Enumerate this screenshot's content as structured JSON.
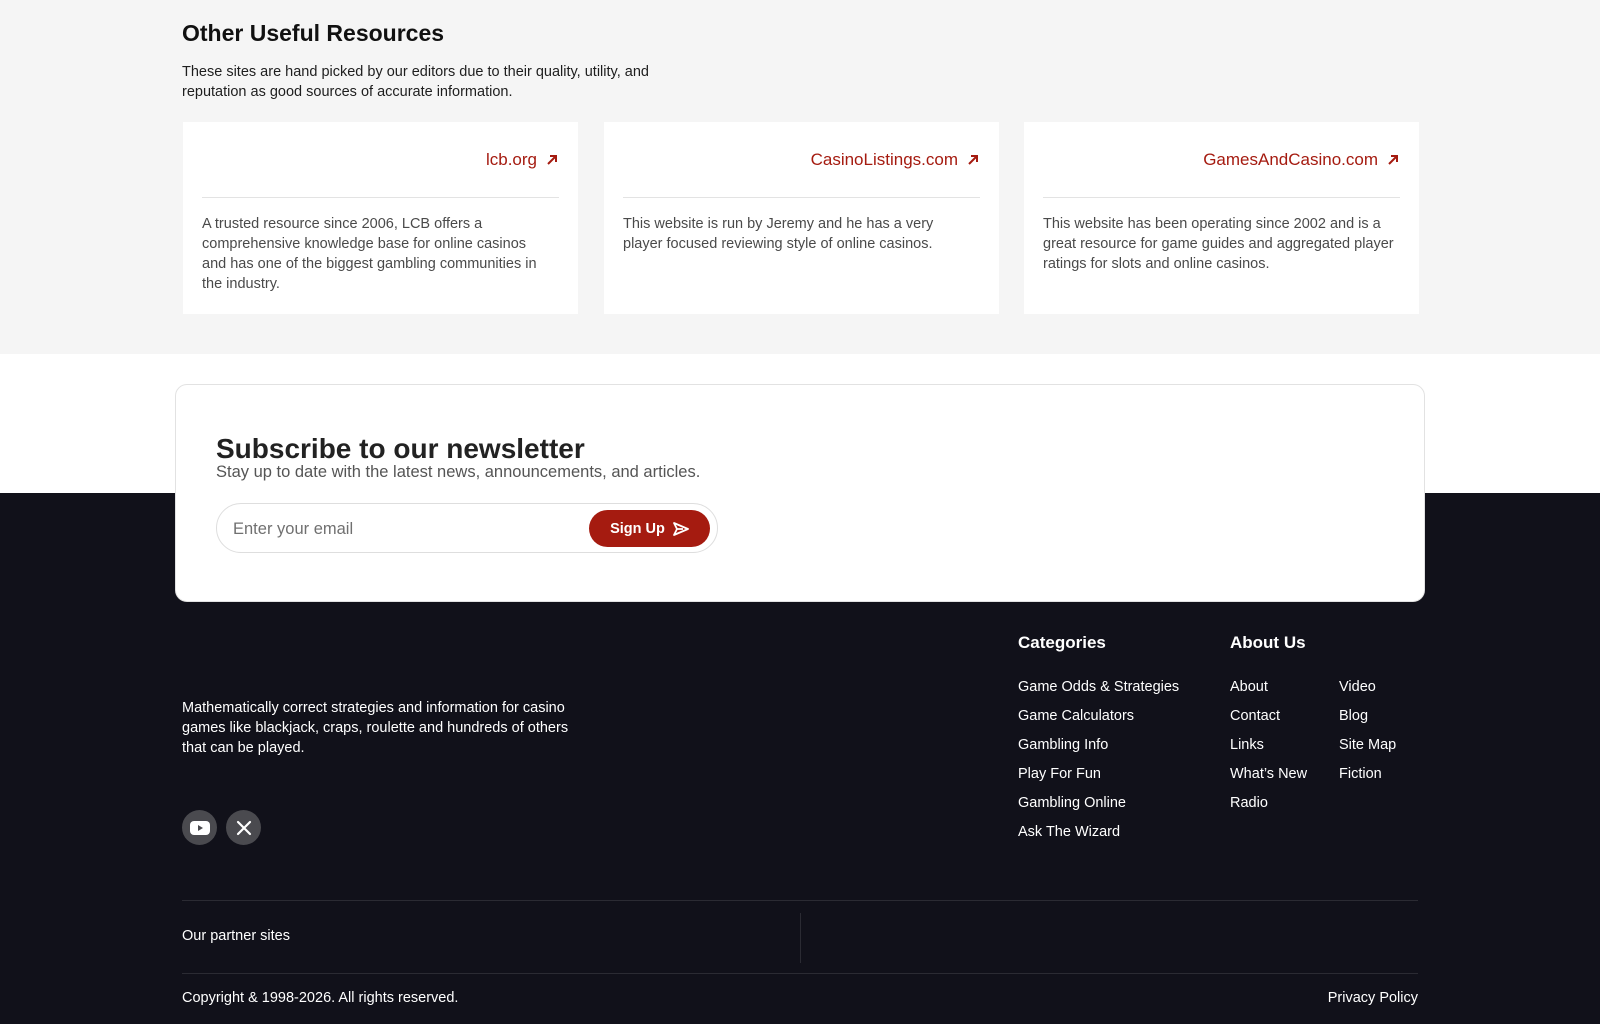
{
  "resources": {
    "title": "Other Useful Resources",
    "subtitle": "These sites are hand picked by our editors due to their quality, utility, and reputation as good sources of accurate information.",
    "cards": [
      {
        "link": "lcb.org",
        "description": "A trusted resource since 2006, LCB offers a comprehensive knowledge base for online casinos and has one of the biggest gambling communities in the industry."
      },
      {
        "link": "CasinoListings.com",
        "description": "This website is run by Jeremy and he has a very player focused reviewing style of online casinos."
      },
      {
        "link": "GamesAndCasino.com",
        "description": "This website has been operating since 2002 and is a great resource for game guides and aggregated player ratings for slots and online casinos."
      }
    ]
  },
  "newsletter": {
    "title": "Subscribe to our newsletter",
    "subtitle": "Stay up to date with the latest news, announcements, and articles.",
    "email_placeholder": "Enter your email",
    "button_label": "Sign Up",
    "button_icon": "send-icon"
  },
  "footer": {
    "description": "Mathematically correct strategies and information for casino games like blackjack, craps, roulette and hundreds of others that can be played.",
    "social": [
      "youtube-icon",
      "x-icon"
    ],
    "categories": {
      "title": "Categories",
      "links": [
        "Game Odds & Strategies",
        "Game Calculators",
        "Gambling Info",
        "Play For Fun",
        "Gambling Online",
        "Ask The Wizard"
      ]
    },
    "about": {
      "title": "About Us",
      "links_col1": [
        "About",
        "Contact",
        "Links",
        "What’s New",
        "Radio"
      ],
      "links_col2": [
        "Video",
        "Blog",
        "Site Map",
        "Fiction"
      ]
    },
    "partner_label": "Our partner sites",
    "copyright": "Copyright & 1998-2026. All rights reserved.",
    "privacy": "Privacy Policy"
  },
  "colors": {
    "accent": "#a51b10",
    "footer_bg": "#11111a",
    "section_bg": "#f5f5f5"
  }
}
